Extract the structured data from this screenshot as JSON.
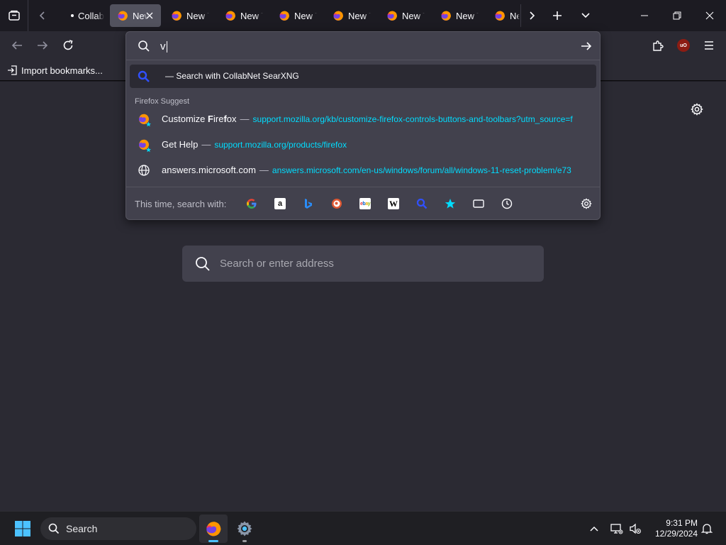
{
  "tabs": [
    {
      "label": "Collab",
      "active": false,
      "pinned_dot": true
    },
    {
      "label": "New Tab",
      "active": true
    },
    {
      "label": "New Tab",
      "active": false
    },
    {
      "label": "New Tab",
      "active": false
    },
    {
      "label": "New Tab",
      "active": false
    },
    {
      "label": "New Tab",
      "active": false
    },
    {
      "label": "New Tab",
      "active": false
    },
    {
      "label": "New Tab",
      "active": false
    },
    {
      "label": "New Tab",
      "active": false
    }
  ],
  "bookmarks": {
    "import_label": "Import bookmarks..."
  },
  "urlbar": {
    "typed_text": "v",
    "heuristic": {
      "text": "— Search with CollabNet SearXNG"
    },
    "group_label": "Firefox Suggest",
    "results": [
      {
        "title_pre": "Customize ",
        "title_bold": "F",
        "title_mid": "ire",
        "title_bold2": "f",
        "title_post": "ox",
        "sep": "—",
        "url": "support.mozilla.org/kb/customize-firefox-controls-buttons-and-toolbars?utm_source=f",
        "icon": "firefox-suggest-icon"
      },
      {
        "title_pre": "Get Help",
        "title_bold": "",
        "title_mid": "",
        "title_bold2": "",
        "title_post": "",
        "sep": "—",
        "url": "support.mozilla.org/products/firefox",
        "icon": "firefox-suggest-icon"
      },
      {
        "title_pre": "answers.microsoft.com",
        "title_bold": "",
        "title_mid": "",
        "title_bold2": "",
        "title_post": "",
        "sep": "—",
        "url": "answers.microsoft.com/en-us/windows/forum/all/windows-11-reset-problem/e73",
        "icon": "globe-icon"
      }
    ],
    "one_off_label": "This time, search with:",
    "one_off_engines": [
      "google",
      "amazon",
      "bing",
      "duckduckgo",
      "ebay",
      "wikipedia",
      "searxng",
      "bookmarks",
      "tabs",
      "history"
    ]
  },
  "page": {
    "search_placeholder": "Search or enter address"
  },
  "taskbar": {
    "search_label": "Search",
    "time": "9:31 PM",
    "date": "12/29/2024"
  },
  "colors": {
    "accent": "#00ddff",
    "background": "#2b2a33",
    "taskbar_indicator": "#4cc2ff"
  }
}
